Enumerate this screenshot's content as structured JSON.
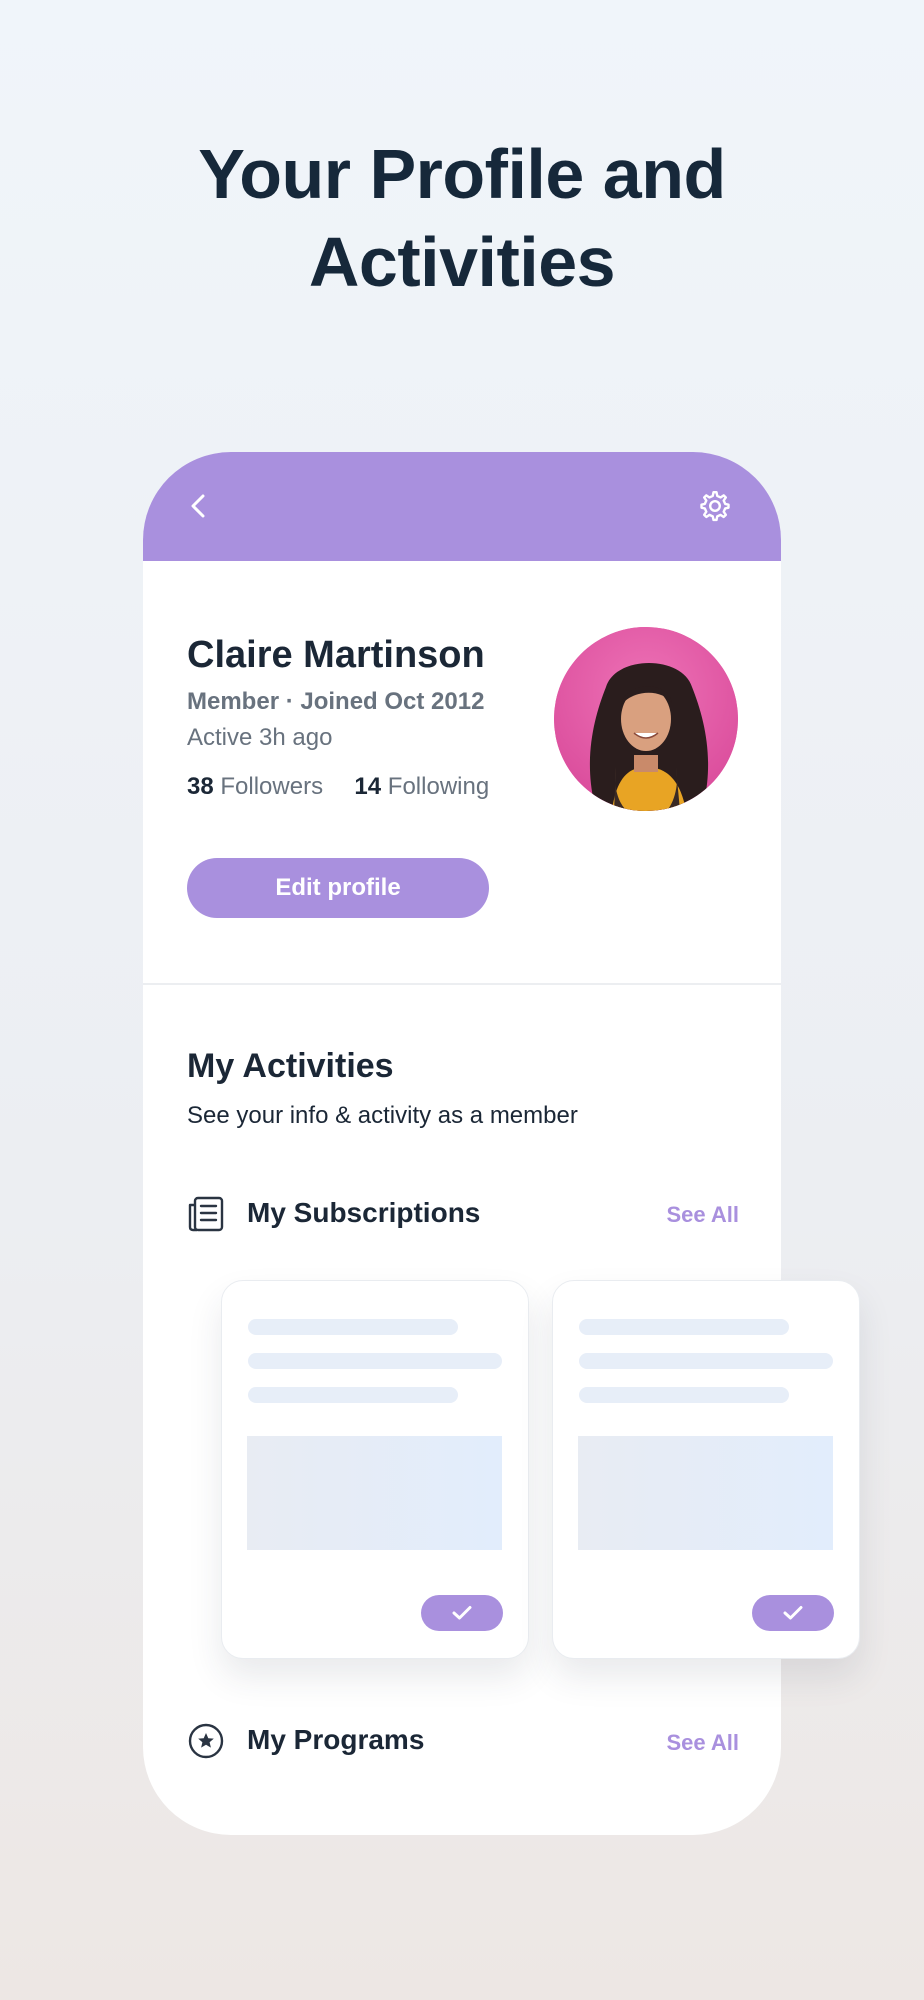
{
  "headline": {
    "line1": "Your Profile and",
    "line2": "Activities"
  },
  "header": {
    "back_icon": "chevron-left",
    "settings_icon": "gear",
    "color": "#a990de"
  },
  "profile": {
    "name": "Claire Martinson",
    "meta": "Member · Joined Oct 2012",
    "active": "Active 3h ago",
    "followers_count": "38",
    "followers_label": "Followers",
    "following_count": "14",
    "following_label": "Following",
    "edit_button": "Edit profile"
  },
  "activities": {
    "title": "My Activities",
    "subtitle": "See your info & activity as a member",
    "subscriptions": {
      "icon": "newspaper",
      "label": "My Subscriptions",
      "see_all": "See All"
    },
    "programs": {
      "icon": "star-circle",
      "label": "My Programs",
      "see_all": "See All"
    }
  },
  "colors": {
    "accent": "#a990de",
    "heading": "#16283a",
    "muted": "#68727e"
  }
}
